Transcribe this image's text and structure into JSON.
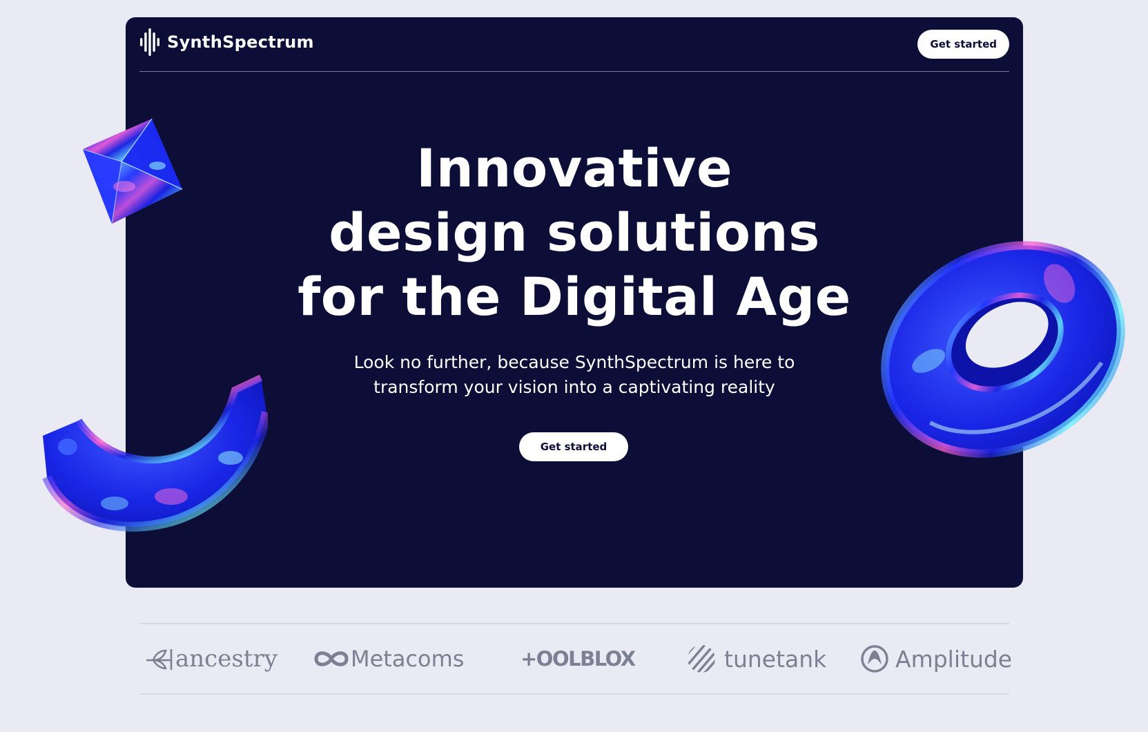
{
  "brand": {
    "name": "SynthSpectrum",
    "logo_icon": "sound-bars-icon"
  },
  "nav": {
    "cta_label": "Get started"
  },
  "hero": {
    "headline_lines": [
      "Innovative",
      "design solutions",
      "for the Digital Age"
    ],
    "subtitle_lines": [
      "Look no further, because SynthSpectrum is here to",
      "transform your vision into a captivating reality"
    ],
    "cta_label": "Get started"
  },
  "partners": [
    {
      "name": "ancestry",
      "icon": "leaf-icon"
    },
    {
      "name": "Metacoms",
      "icon": "infinity-icon"
    },
    {
      "name": "+OOLBLOX",
      "icon": ""
    },
    {
      "name": "tunetank",
      "icon": "striped-circle-icon"
    },
    {
      "name": "Amplitude",
      "icon": "amplitude-icon"
    }
  ],
  "colors": {
    "page_bg": "#e9eaf4",
    "hero_bg": "#0c0e38",
    "button_bg": "#ffffff",
    "partner_gray": "#7d7f92",
    "shape_blue": "#1f2fe8"
  }
}
